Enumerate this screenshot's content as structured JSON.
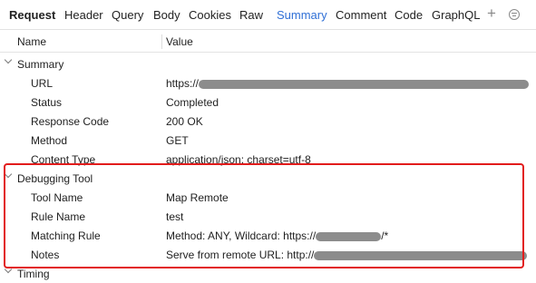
{
  "tabs": {
    "title": "Request",
    "items": [
      {
        "label": "Header"
      },
      {
        "label": "Query"
      },
      {
        "label": "Body"
      },
      {
        "label": "Cookies"
      },
      {
        "label": "Raw"
      },
      {
        "label": "Summary",
        "active": true
      },
      {
        "label": "Comment"
      },
      {
        "label": "Code"
      },
      {
        "label": "GraphQL"
      }
    ],
    "add_glyph": "+",
    "add_icon": "plus-icon",
    "filter_icon": "filter-icon",
    "active_color": "#2f6fd6"
  },
  "columns": {
    "name": "Name",
    "value": "Value"
  },
  "summary": {
    "title": "Summary",
    "rows": [
      {
        "key": "URL",
        "value": "https://",
        "redacted": true
      },
      {
        "key": "Status",
        "value": "Completed"
      },
      {
        "key": "Response Code",
        "value": "200 OK"
      },
      {
        "key": "Method",
        "value": "GET"
      },
      {
        "key": "Content Type",
        "value": "application/json; charset=utf-8"
      }
    ]
  },
  "debugging": {
    "title": "Debugging Tool",
    "rows": [
      {
        "key": "Tool Name",
        "value": "Map Remote"
      },
      {
        "key": "Rule Name",
        "value": "test"
      },
      {
        "key": "Matching Rule",
        "value": "Method: ANY, Wildcard: https://",
        "value_suffix": "/*",
        "redacted": true
      },
      {
        "key": "Notes",
        "value": "Serve from remote URL: http://",
        "redacted": true
      }
    ],
    "highlight_color": "#e21c1c"
  },
  "timing": {
    "title": "Timing"
  }
}
